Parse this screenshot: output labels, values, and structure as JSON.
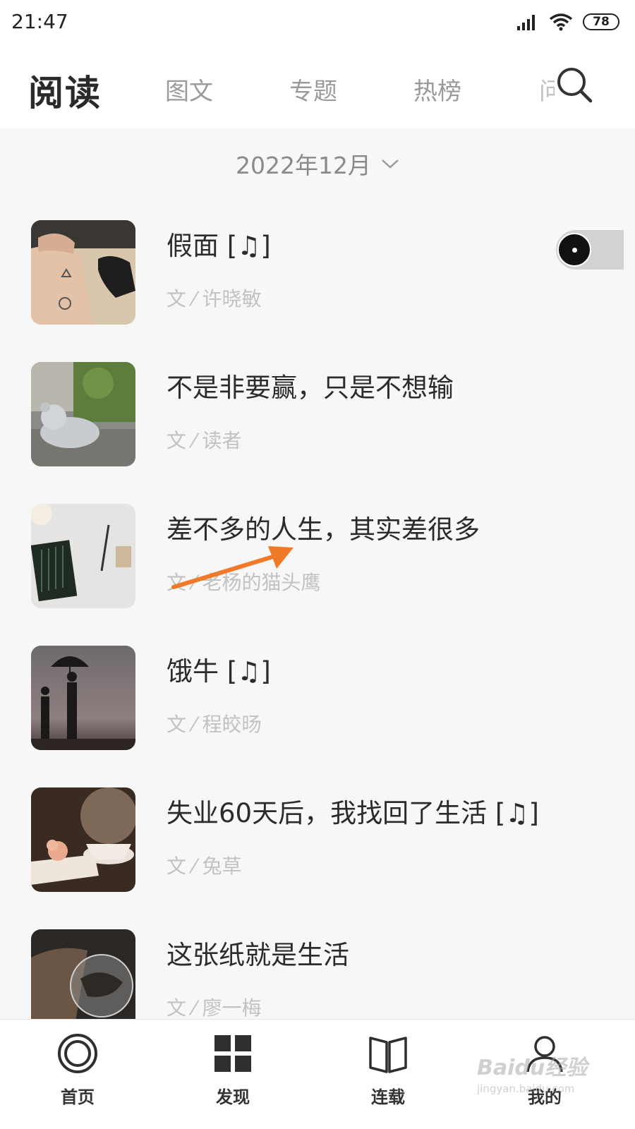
{
  "status_bar": {
    "time": "21:47",
    "battery": "78",
    "icons": [
      "signal-icon",
      "wifi-icon",
      "battery-icon"
    ]
  },
  "header": {
    "title": "阅读",
    "tabs": [
      {
        "label": "图文"
      },
      {
        "label": "专题"
      },
      {
        "label": "热榜"
      },
      {
        "label": "问"
      }
    ],
    "search_icon": "search-icon"
  },
  "month_selector": {
    "label": "2022年12月",
    "icon": "chevron-down-icon"
  },
  "articles": [
    {
      "title": "假面 [♫]",
      "author": "文 ⁄ 许晓敏",
      "image": "wrist-tattoo-photo"
    },
    {
      "title": "不是非要赢，只是不想输",
      "author": "文 ⁄ 读者",
      "image": "teddy-bear-photo"
    },
    {
      "title": "差不多的人生，其实差很多",
      "author": "文 ⁄ 老杨的猫头鹰",
      "image": "desk-pencils-photo"
    },
    {
      "title": "饿牛 [♫]",
      "author": "文 ⁄ 程皎旸",
      "image": "umbrella-silhouette-photo"
    },
    {
      "title": "失业60天后，我找回了生活 [♫]",
      "author": "文 ⁄ 兔草",
      "image": "teacup-photo"
    },
    {
      "title": "这张纸就是生活",
      "author": "文 ⁄ 廖一梅",
      "image": "crystal-ball-photo"
    }
  ],
  "floating_player": {
    "icon": "music-disc-icon"
  },
  "annotation": {
    "color": "#f07a2a",
    "icon": "arrow-annotation"
  },
  "bottom_nav": [
    {
      "label": "首页",
      "icon": "home-circle-icon"
    },
    {
      "label": "发现",
      "icon": "grid-icon"
    },
    {
      "label": "连载",
      "icon": "book-icon"
    },
    {
      "label": "我的",
      "icon": "profile-icon"
    }
  ],
  "watermark": {
    "main": "Baidu经验",
    "sub": "jingyan.baidu.com"
  },
  "colors": {
    "background": "#f7f7f7",
    "title": "#2b2b2b",
    "muted": "#c2c2c2",
    "tab": "#9a9a9a"
  }
}
